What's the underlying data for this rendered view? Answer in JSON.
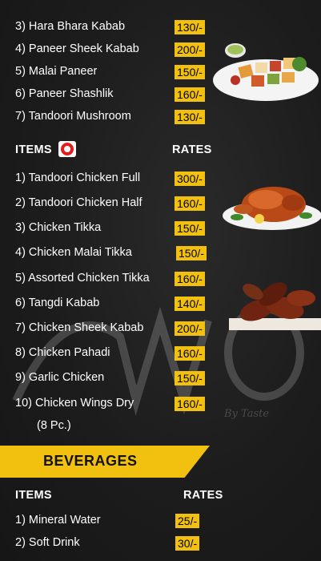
{
  "veg_items": [
    {
      "name": "3) Hara Bhara Kabab",
      "price": "130/-"
    },
    {
      "name": "4) Paneer Sheek Kabab",
      "price": "200/-"
    },
    {
      "name": "5) Malai Paneer",
      "price": "150/-"
    },
    {
      "name": "6) Paneer Shashlik",
      "price": "160/-"
    },
    {
      "name": "7) Tandoori Mushroom",
      "price": "130/-"
    }
  ],
  "nonveg_section": {
    "items_header": "ITEMS",
    "rates_header": "RATES"
  },
  "nonveg_items": [
    {
      "name": "1) Tandoori Chicken Full",
      "price": "300/-"
    },
    {
      "name": "2) Tandoori Chicken Half",
      "price": "160/-"
    },
    {
      "name": "3) Chicken Tikka",
      "price": "150/-"
    },
    {
      "name": "4) Chicken Malai Tikka",
      "price": "150/-"
    },
    {
      "name": "5) Assorted Chicken Tikka",
      "price": "160/-"
    },
    {
      "name": "6) Tangdi Kabab",
      "price": "140/-"
    },
    {
      "name": "7) Chicken Sheek Kabab",
      "price": "200/-"
    },
    {
      "name": "8) Chicken Pahadi",
      "price": "160/-"
    },
    {
      "name": "9) Garlic Chicken",
      "price": "150/-"
    },
    {
      "name": "10) Chicken Wings Dry",
      "price": "160/-"
    }
  ],
  "wings_note": "(8 Pc.)",
  "watermark_text": "By Taste",
  "beverages": {
    "title": "BEVERAGES",
    "items_header": "ITEMS",
    "rates_header": "RATES",
    "items": [
      {
        "name": "1) Mineral Water",
        "price": "25/-"
      },
      {
        "name": "2) Soft Drink",
        "price": "30/-"
      }
    ]
  },
  "colors": {
    "background": "#1c1c1c",
    "price_tag": "#f2c10f",
    "banner": "#f2c10f",
    "badge": "#e21d1d"
  },
  "icons": [
    "non-veg-badge-icon",
    "paneer-tikka-plate-image",
    "tandoori-chicken-image",
    "chicken-wings-image"
  ]
}
